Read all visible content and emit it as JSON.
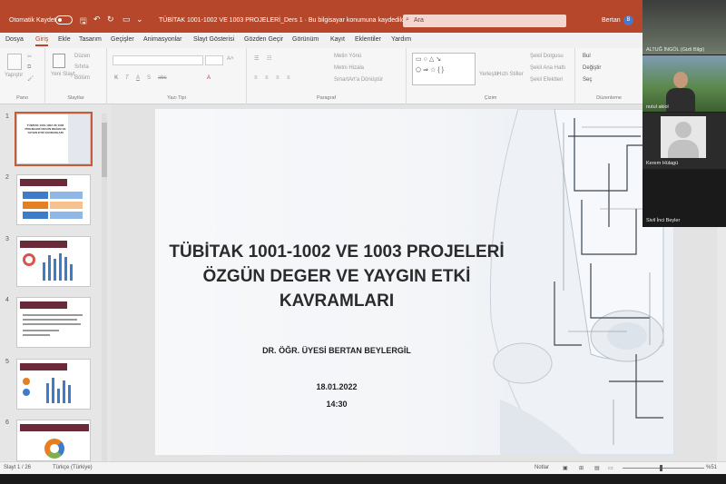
{
  "titlebar": {
    "autosave_label": "Otomatik Kaydet",
    "doc_title": "TÜBİTAK 1001-1002 VE 1003 PROJELERİ_Ders 1  ·  Bu bilgisayar konumuna kaydedildi  ·",
    "search_placeholder": "Ara",
    "user_name": "Bertan",
    "user_initial": "B"
  },
  "menu": {
    "tabs": [
      "Dosya",
      "Giriş",
      "Ekle",
      "Tasarım",
      "Geçişler",
      "Animasyonlar",
      "Slayt Gösterisi",
      "Gözden Geçir",
      "Görünüm",
      "Kayıt",
      "Eklentiler",
      "Yardım"
    ],
    "active": "Giriş"
  },
  "ribbon": {
    "paste_label": "Yapıştır",
    "new_slide_label": "Yeni Slayt",
    "layout_label": "Düzen",
    "reset_label": "Sıfırla",
    "section_label": "Bölüm",
    "groups": {
      "clipboard": "Pano",
      "slides": "Slaytlar",
      "font": "Yazı Tipi",
      "paragraph": "Paragraf",
      "drawing": "Çizim",
      "editing": "Düzenleme"
    },
    "text_direction": "Metin Yönü",
    "align_text": "Metni Hizala",
    "smartart": "SmartArt'a Dönüştür",
    "arrange": "Yerleştir",
    "quick_styles": "Hızlı Stiller",
    "shape_fill": "Şekil Dolgusu",
    "shape_outline": "Şekil Ana Hattı",
    "shape_effects": "Şekil Efektleri",
    "find": "Bul",
    "replace": "Değiştir",
    "select": "Seç"
  },
  "thumbnails": {
    "numbers": [
      "1",
      "2",
      "3",
      "4",
      "5",
      "6"
    ],
    "selected": 1,
    "t1_title": "TÜBİTAK 1001-1002 VE 1003 PROJELERİ ÖZGÜN DEĞER VE YAYGIN ETKİ KAVRAMLARI"
  },
  "slide": {
    "title_line1": "TÜBİTAK 1001-1002 VE 1003 PROJELERİ",
    "title_line2": "ÖZGÜN DEGER VE YAYGIN ETKİ",
    "title_line3": "KAVRAMLARI",
    "author": "DR. ÖĞR. ÜYESİ BERTAN BEYLERGİL",
    "date": "18.01.2022",
    "time": "14:30"
  },
  "statusbar": {
    "slide_count": "Slayt 1 / 26",
    "language": "Türkçe (Türkiye)",
    "notes": "Notlar",
    "zoom": "%51"
  },
  "participants": [
    {
      "name": "ALTUĞ İNGÖL (Gizli Bilgi)"
    },
    {
      "name": "nutul akiol"
    },
    {
      "name": "Kerem Hülagü"
    },
    {
      "name": "Sivil İnci Beyler"
    }
  ],
  "colors": {
    "accent": "#b7472a",
    "title_text": "#2b2b2b"
  }
}
